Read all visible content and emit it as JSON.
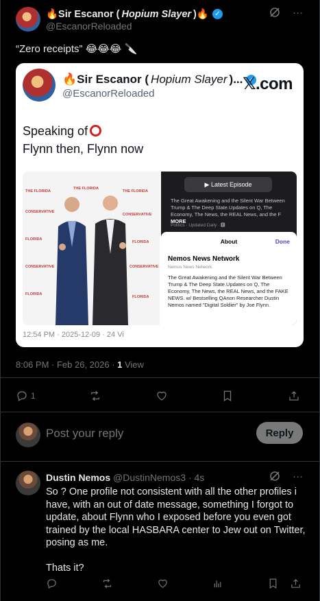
{
  "post": {
    "name_prefix": "🔥Sir Escanor (",
    "name_nick": "Hopium Slayer",
    "name_suffix": ")🔥",
    "handle": "@EscanorReloaded",
    "text": "“Zero receipts” 😂😂😂 🔪",
    "timestamp": "8:06 PM · Feb 26, 2026 · ",
    "views_count": "1",
    "views_label": " View"
  },
  "quote": {
    "name_prefix": "🔥Sir Escanor (",
    "name_nick": "Hopium Slayer",
    "name_suffix": ")...",
    "handle": "@EscanorReloaded",
    "logo": "𝕏.com",
    "line1": "Speaking of",
    "line2": "Flynn then, Flynn now",
    "footer": "12:54 PM · 2025-12-09 · 24 Vi",
    "photo_banner": "THE FLORIDA CONSERVATIVE",
    "podcast": {
      "latest_button": "▶ Latest Episode",
      "description": "The Great Awakening and the Silent War Between Trump & The Deep State.Updates on Q, The Economy, The News, the REAL News, and the F",
      "more": "MORE",
      "category": "Politics · Updated Daily · 🅴",
      "sheet_title_small": "About",
      "sheet_done": "Done",
      "sheet_title": "Nemos News Network",
      "sheet_subtitle": "Nemos News Network",
      "sheet_description": "The Great Awakening and the Silent War Between Trump & The Deep State.Updates on Q, The Economy, The News, the REAL News, and the FAKE NEWS. w/ Bestselling QAnon Researcher Dustin Nemos named \"Digital Soldier\" by Joe Flynn."
    }
  },
  "actions": {
    "reply_count": "1"
  },
  "reply_box": {
    "placeholder": "Post your reply",
    "button": "Reply"
  },
  "reply": {
    "name": "Dustin Nemos",
    "handle": "@DustinNemos3",
    "time": "· 4s",
    "paragraph1": "So ? One profile not consistent with all the other profiles i have, with an out of date message, something I forgot to update, about Flynn who I exposed before you even got trained by the local HASBARA center to Jew out on Twitter, posing as me.",
    "paragraph2": "Thats it?"
  },
  "colors": {
    "background": "#000000",
    "text": "#e7e9ea",
    "muted": "#71767b",
    "verified": "#1d9bf0",
    "divider": "#2f3336"
  }
}
